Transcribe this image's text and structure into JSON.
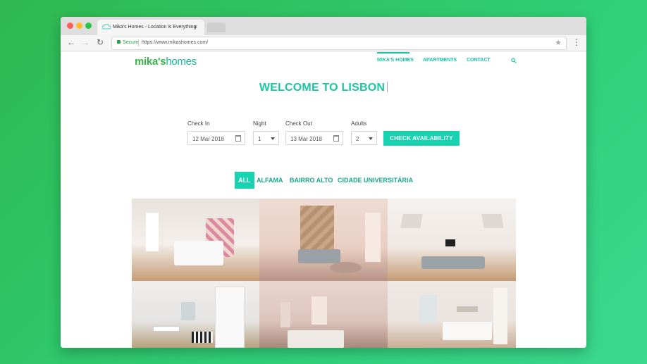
{
  "browser": {
    "tab_title": "Mika's Homes - Location is Everything",
    "tab_close": "×",
    "secure_label": "Secure",
    "url": "https://www.mikashomes.com/",
    "back_icon": "arrow-left-icon",
    "forward_icon": "arrow-right-icon",
    "reload_icon": "reload-icon",
    "star_icon": "star-icon",
    "menu_icon": "kebab-menu-icon"
  },
  "site": {
    "logo_part1": "mika's",
    "logo_part2": "homes",
    "nav": [
      "MIKA'S HOMES",
      "APARTMENTS",
      "CONTACT"
    ],
    "active_nav": "MIKA'S HOMES",
    "accent_color": "#18c6a4",
    "button_color": "#18d3b0"
  },
  "hero": {
    "title": "WELCOME TO LISBON"
  },
  "booking": {
    "checkin_label": "Check In",
    "checkin_value": "12 Mar 2018",
    "night_label": "Night",
    "night_value": "1",
    "checkout_label": "Check Out",
    "checkout_value": "13 Mar 2018",
    "adults_label": "Adults",
    "adults_value": "2",
    "submit_label": "CHECK AVAILABILITY"
  },
  "filters": [
    "ALL",
    "ALFAMA",
    "BAIRRO ALTO",
    "CIDADE UNIVERSITÁRIA"
  ],
  "active_filter": "ALL",
  "gallery": [
    "bedroom-photo",
    "living-room-photo",
    "lounge-photo",
    "studio-photo",
    "kitchen-photo",
    "bedroom-2-photo"
  ]
}
